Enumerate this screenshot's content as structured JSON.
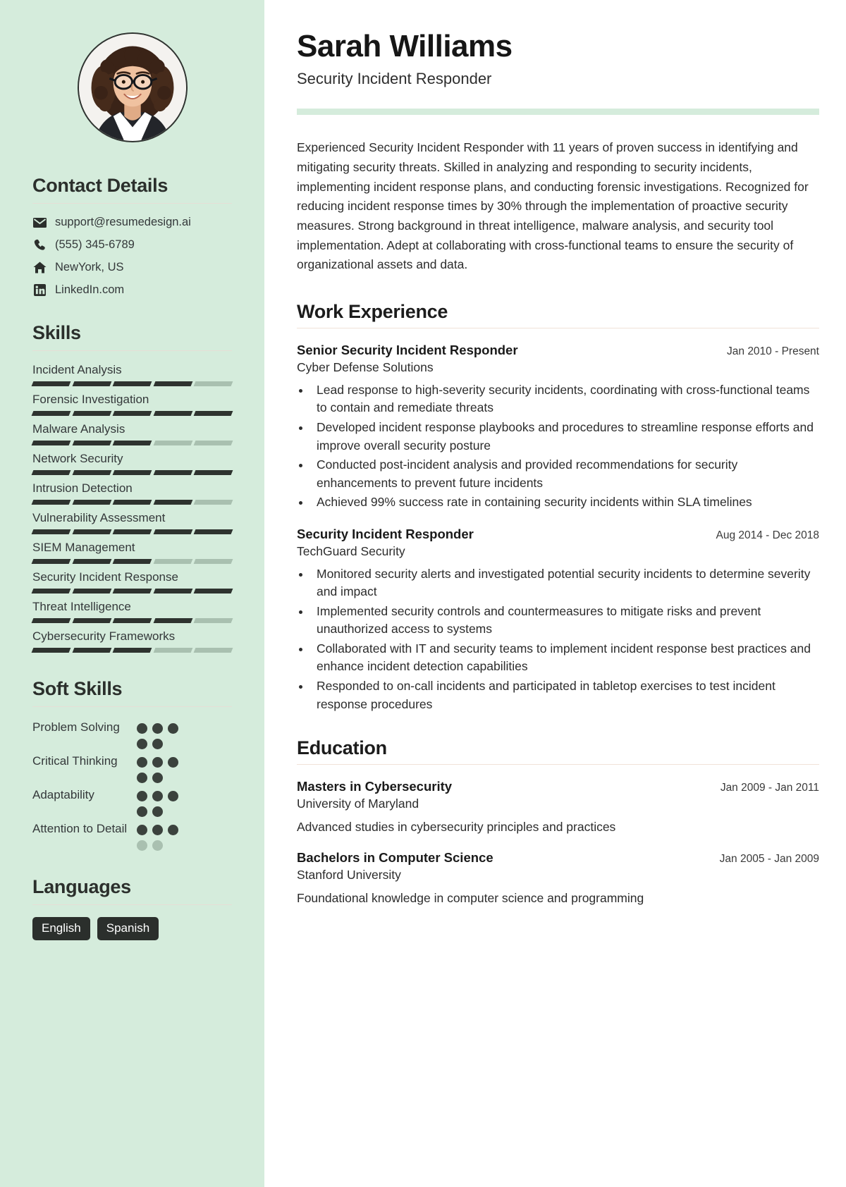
{
  "sidebar": {
    "avatar": {
      "icon": "profile-photo"
    },
    "contact": {
      "heading": "Contact Details",
      "items": [
        {
          "icon": "email-icon",
          "value": "support@resumedesign.ai"
        },
        {
          "icon": "phone-icon",
          "value": "(555) 345-6789"
        },
        {
          "icon": "home-icon",
          "value": "NewYork, US"
        },
        {
          "icon": "linkedin-icon",
          "value": "LinkedIn.com"
        }
      ]
    },
    "skills": {
      "heading": "Skills",
      "max": 5,
      "items": [
        {
          "name": "Incident Analysis",
          "level": 4
        },
        {
          "name": "Forensic Investigation",
          "level": 5
        },
        {
          "name": "Malware Analysis",
          "level": 3
        },
        {
          "name": "Network Security",
          "level": 5
        },
        {
          "name": "Intrusion Detection",
          "level": 4
        },
        {
          "name": "Vulnerability Assessment",
          "level": 5
        },
        {
          "name": "SIEM Management",
          "level": 3
        },
        {
          "name": "Security Incident Response",
          "level": 5
        },
        {
          "name": "Threat Intelligence",
          "level": 4
        },
        {
          "name": "Cybersecurity Frameworks",
          "level": 3
        }
      ]
    },
    "soft_skills": {
      "heading": "Soft Skills",
      "max": 5,
      "items": [
        {
          "name": "Problem Solving",
          "level": 5
        },
        {
          "name": "Critical Thinking",
          "level": 5
        },
        {
          "name": "Adaptability",
          "level": 5
        },
        {
          "name": "Attention to Detail",
          "level": 3
        }
      ]
    },
    "languages": {
      "heading": "Languages",
      "items": [
        "English",
        "Spanish"
      ]
    }
  },
  "main": {
    "name": "Sarah Williams",
    "title": "Security Incident Responder",
    "summary": "Experienced Security Incident Responder with 11 years of proven success in identifying and mitigating security threats. Skilled in analyzing and responding to security incidents, implementing incident response plans, and conducting forensic investigations. Recognized for reducing incident response times by 30% through the implementation of proactive security measures. Strong background in threat intelligence, malware analysis, and security tool implementation. Adept at collaborating with cross-functional teams to ensure the security of organizational assets and data.",
    "work": {
      "heading": "Work Experience",
      "entries": [
        {
          "title": "Senior Security Incident Responder",
          "date": "Jan 2010 - Present",
          "org": "Cyber Defense Solutions",
          "bullets": [
            "Lead response to high-severity security incidents, coordinating with cross-functional teams to contain and remediate threats",
            "Developed incident response playbooks and procedures to streamline response efforts and improve overall security posture",
            "Conducted post-incident analysis and provided recommendations for security enhancements to prevent future incidents",
            "Achieved 99% success rate in containing security incidents within SLA timelines"
          ]
        },
        {
          "title": "Security Incident Responder",
          "date": "Aug 2014 - Dec 2018",
          "org": "TechGuard Security",
          "bullets": [
            "Monitored security alerts and investigated potential security incidents to determine severity and impact",
            "Implemented security controls and countermeasures to mitigate risks and prevent unauthorized access to systems",
            "Collaborated with IT and security teams to implement incident response best practices and enhance incident detection capabilities",
            "Responded to on-call incidents and participated in tabletop exercises to test incident response procedures"
          ]
        }
      ]
    },
    "education": {
      "heading": "Education",
      "entries": [
        {
          "title": "Masters in Cybersecurity",
          "date": "Jan 2009 - Jan 2011",
          "org": "University of Maryland",
          "desc": "Advanced studies in cybersecurity principles and practices"
        },
        {
          "title": "Bachelors in Computer Science",
          "date": "Jan 2005 - Jan 2009",
          "org": "Stanford University",
          "desc": "Foundational knowledge in computer science and programming"
        }
      ]
    }
  }
}
